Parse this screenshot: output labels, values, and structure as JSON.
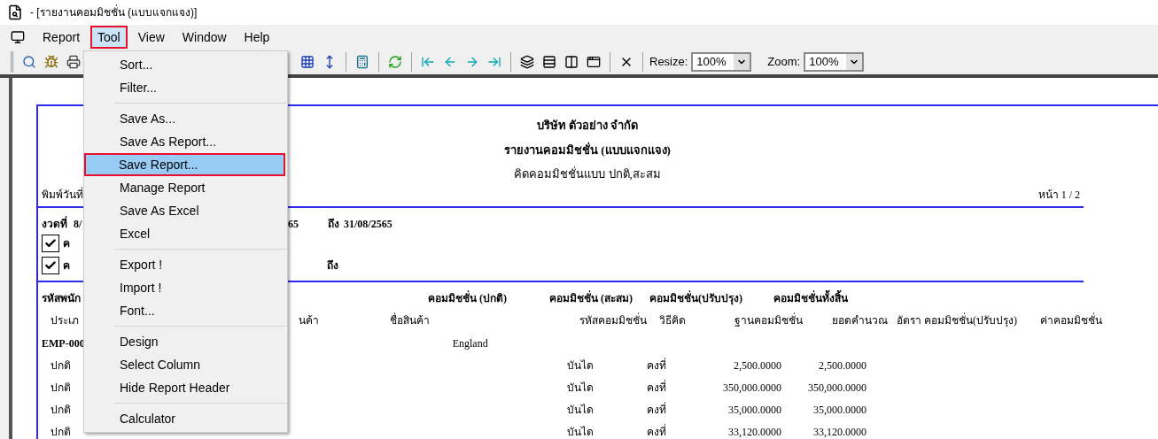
{
  "window": {
    "title": "- [รายงานคอมมิชชั่น (แบบแจกแจง)]"
  },
  "menubar": [
    {
      "label": "Report",
      "selected": false
    },
    {
      "label": "Tool",
      "selected": true
    },
    {
      "label": "View",
      "selected": false
    },
    {
      "label": "Window",
      "selected": false
    },
    {
      "label": "Help",
      "selected": false
    }
  ],
  "toolbar": {
    "resize": {
      "label": "Resize:",
      "value": "100%"
    },
    "zoom": {
      "label": "Zoom:",
      "value": "100%"
    }
  },
  "tool_menu": [
    [
      {
        "label": "Sort...",
        "selected": false
      },
      {
        "label": "Filter...",
        "selected": false
      }
    ],
    [
      {
        "label": "Save As...",
        "selected": false
      },
      {
        "label": "Save As Report...",
        "selected": false
      },
      {
        "label": "Save Report...",
        "selected": true
      },
      {
        "label": "Manage Report",
        "selected": false
      },
      {
        "label": "Save As Excel",
        "selected": false
      },
      {
        "label": "Excel",
        "selected": false
      }
    ],
    [
      {
        "label": "Export !",
        "selected": false
      },
      {
        "label": "Import !",
        "selected": false
      },
      {
        "label": "Font...",
        "selected": false
      }
    ],
    [
      {
        "label": "Design",
        "selected": false
      },
      {
        "label": "Select Column",
        "selected": false
      },
      {
        "label": "Hide Report Header",
        "selected": false
      }
    ],
    [
      {
        "label": "Calculator",
        "selected": false
      }
    ]
  ],
  "report": {
    "titles": [
      "บริษัท ตัวอย่าง จำกัด",
      "รายงานคอมมิชชั่น (แบบแจกแจง)",
      "คิดคอมมิชชั่นแบบ ปกติ,สะสม"
    ],
    "print_date_label": "พิมพ์วันที่",
    "page": "หน้า 1 / 2",
    "period": {
      "label": "งวดที่",
      "from_fragment": "8/",
      "mid_fragment": "65",
      "to_label": "ถึง",
      "to": "31/08/2565"
    },
    "options": [
      {
        "checked": true,
        "label": "ค"
      },
      {
        "checked": true,
        "label": "ค",
        "to_label": "ถึง"
      }
    ],
    "header_1": {
      "column_1": "รหัสพนัก",
      "normal": "คอมมิชชั่น (ปกติ)",
      "accumulated": "คอมมิชชั่น (สะสม)",
      "adjusted": "คอมมิชชั่น(ปรับปรุง)",
      "total": "คอมมิชชั่นทั้งสิ้น"
    },
    "header_2": {
      "column_1": "ประเภ",
      "column_2": "นค้า",
      "product_name": "ชื่อสินค้า",
      "commission_code": "รหัสคอมมิชชั่น",
      "method": "วิธีคิด",
      "base": "ฐานคอมมิชชั่น",
      "calculated": "ยอดคำนวณ",
      "rate": "อัตรา คอมมิชชั่น(ปรับปรุง)",
      "commission": "ค่าคอมมิชชั่น"
    },
    "group": {
      "employee": "EMP-000",
      "country": "England"
    },
    "rows": [
      {
        "type": "ปกติ",
        "code": "บันได",
        "method": "คงที่",
        "base": "2,500.0000",
        "calculated": "2,500.0000"
      },
      {
        "type": "ปกติ",
        "code": "บันได",
        "method": "คงที่",
        "base": "350,000.0000",
        "calculated": "350,000.0000"
      },
      {
        "type": "ปกติ",
        "code": "บันได",
        "method": "คงที่",
        "base": "35,000.0000",
        "calculated": "35,000.0000"
      },
      {
        "type": "ปกติ",
        "code": "บันได",
        "method": "คงที่",
        "base": "33,120.0000",
        "calculated": "33,120.0000"
      }
    ]
  }
}
